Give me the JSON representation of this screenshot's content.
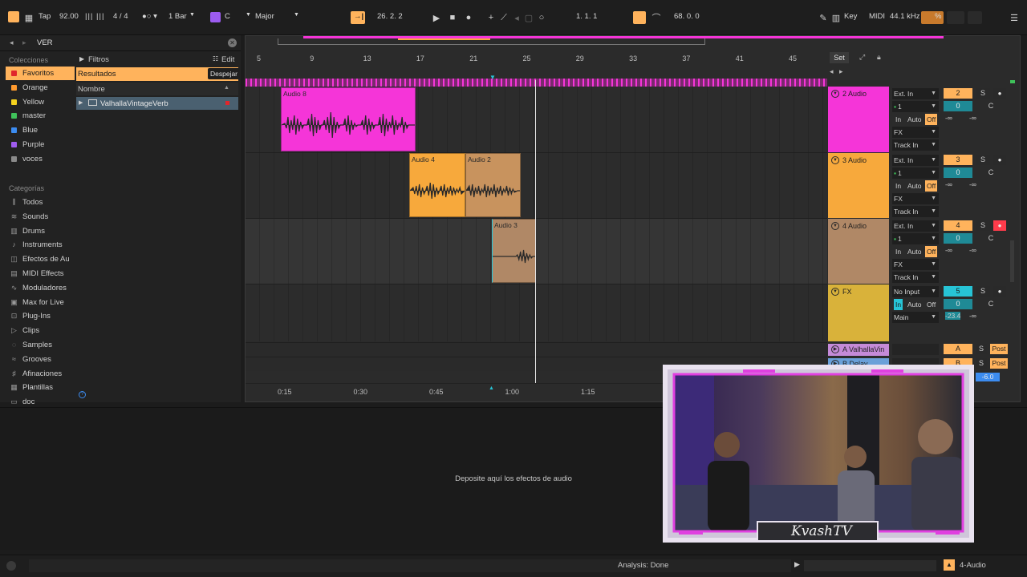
{
  "transport": {
    "tap_label": "Tap",
    "tempo": "92.00",
    "time_signature": "4 / 4",
    "quantize": "1 Bar",
    "key_root": "C",
    "key_scale": "Major",
    "position": "26.   2.   2",
    "loop_start": "1.   1.   1",
    "loop_length": "68.   0.   0",
    "key_label": "Key",
    "midi_label": "MIDI",
    "sample_rate": "44.1 kHz",
    "cpu": "%"
  },
  "browser": {
    "search_value": "VER",
    "collections_heading": "Colecciones",
    "collections": [
      {
        "label": "Favoritos",
        "color": "#e0262c"
      },
      {
        "label": "Orange",
        "color": "#ff9a2e"
      },
      {
        "label": "Yellow",
        "color": "#f5d21e"
      },
      {
        "label": "master",
        "color": "#3fc25a"
      },
      {
        "label": "Blue",
        "color": "#3c8cf0"
      },
      {
        "label": "Purple",
        "color": "#a05cf0"
      },
      {
        "label": "voces",
        "color": "#8a8a8a"
      }
    ],
    "categories_heading": "Categorías",
    "categories": [
      {
        "label": "Todos",
        "icon": "library-icon"
      },
      {
        "label": "Sounds",
        "icon": "sounds-icon"
      },
      {
        "label": "Drums",
        "icon": "drums-icon"
      },
      {
        "label": "Instruments",
        "icon": "instruments-icon"
      },
      {
        "label": "Efectos de Au",
        "icon": "audio-effects-icon"
      },
      {
        "label": "MIDI Effects",
        "icon": "midi-effects-icon"
      },
      {
        "label": "Moduladores",
        "icon": "modulators-icon"
      },
      {
        "label": "Max for Live",
        "icon": "max-for-live-icon"
      },
      {
        "label": "Plug-Ins",
        "icon": "plugins-icon"
      },
      {
        "label": "Clips",
        "icon": "clips-icon"
      },
      {
        "label": "Samples",
        "icon": "samples-icon"
      },
      {
        "label": "Grooves",
        "icon": "grooves-icon"
      },
      {
        "label": "Afinaciones",
        "icon": "tunings-icon"
      },
      {
        "label": "Plantillas",
        "icon": "templates-icon"
      },
      {
        "label": "doc",
        "icon": "folder-icon"
      }
    ],
    "filters_label": "Filtros",
    "edit_label": "Edit",
    "results_label": "Resultados",
    "clear_label": "Despejar",
    "name_column": "Nombre",
    "result_items": [
      "ValhallaVintageVerb"
    ]
  },
  "arrangement": {
    "bar_numbers": [
      "5",
      "9",
      "13",
      "17",
      "21",
      "25",
      "29",
      "33",
      "37",
      "41",
      "45"
    ],
    "time_labels": [
      "0:15",
      "0:30",
      "0:45",
      "1:00",
      "1:15"
    ],
    "set_label": "Set",
    "clips": [
      {
        "name": "Audio 8",
        "color": "#f535d8"
      },
      {
        "name": "Audio 4",
        "color": "#f7a93c"
      },
      {
        "name": "Audio 2",
        "color": "#c8935e"
      },
      {
        "name": "Audio 3",
        "color": "#b08866"
      }
    ],
    "tracks": [
      {
        "name": "2 Audio",
        "color": "#f535d8",
        "input": "Ext. In",
        "channel": "1",
        "monitor": [
          "In",
          "Auto",
          "Off"
        ],
        "send": "FX",
        "output": "Track In",
        "number": "2",
        "solo": "S",
        "volume": "0",
        "pan": "C",
        "left": "-∞",
        "right": "-∞"
      },
      {
        "name": "3 Audio",
        "color": "#f7a93c",
        "input": "Ext. In",
        "channel": "1",
        "monitor": [
          "In",
          "Auto",
          "Off"
        ],
        "send": "FX",
        "output": "Track In",
        "number": "3",
        "solo": "S",
        "volume": "0",
        "pan": "C",
        "left": "-∞",
        "right": "-∞"
      },
      {
        "name": "4 Audio",
        "color": "#b08866",
        "input": "Ext. In",
        "channel": "1",
        "monitor": [
          "In",
          "Auto",
          "Off"
        ],
        "send": "FX",
        "output": "Track In",
        "number": "4",
        "solo": "S",
        "volume": "0",
        "pan": "C",
        "left": "-∞",
        "right": "-∞"
      },
      {
        "name": "FX",
        "color": "#d9b23a",
        "input": "No Input",
        "monitor": [
          "In",
          "Auto",
          "Off"
        ],
        "output": "Main",
        "number": "5",
        "solo": "S",
        "volume": "0",
        "pan": "C",
        "left": "-23.4",
        "right": "-∞"
      }
    ],
    "returns": [
      {
        "name": "A ValhallaVin",
        "letter": "A",
        "solo": "S",
        "mode": "Post"
      },
      {
        "name": "B Delay",
        "letter": "B",
        "solo": "S",
        "mode": "Post"
      }
    ],
    "master_volume": "-6.0"
  },
  "detail": {
    "drop_hint": "Deposite aquí los efectos de audio"
  },
  "status": {
    "analysis": "Analysis: Done",
    "selected_track": "4-Audio"
  },
  "overlay": {
    "watermark": "KvashTV"
  },
  "colors": {
    "accent": "#ffb35c",
    "pink": "#f535d8",
    "orange": "#f7a93c",
    "brown": "#b08866",
    "cyan": "#27c4d6",
    "record_red": "#ff3b4b"
  }
}
